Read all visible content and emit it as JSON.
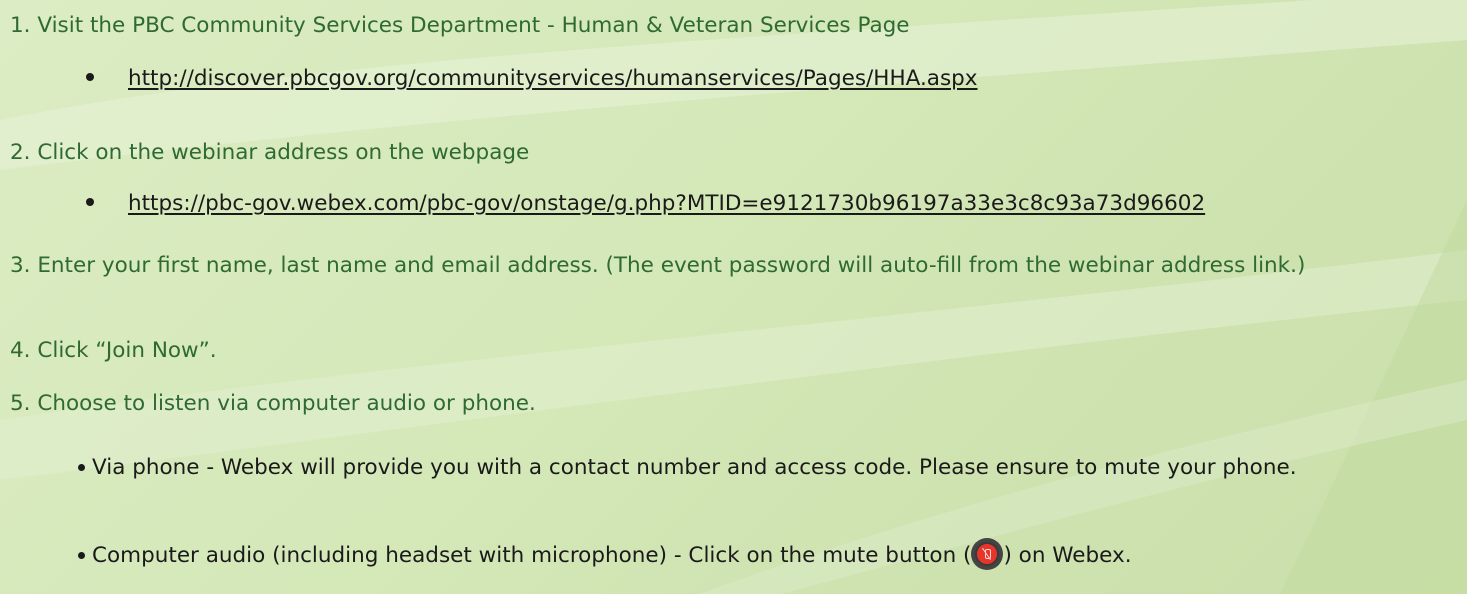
{
  "steps": {
    "s1": "1. Visit the PBC Community Services Department - Human & Veteran Services Page",
    "s1_link": "http://discover.pbcgov.org/communityservices/humanservices/Pages/HHA.aspx",
    "s2": "2. Click on the webinar address on the webpage",
    "s2_link": "https://pbc-gov.webex.com/pbc-gov/onstage/g.php?MTID=e9121730b96197a33e3c8c93a73d96602",
    "s3": "3. Enter your first name, last name and email address.  (The event password will auto-fill from the webinar address link.)",
    "s4": "4. Click “Join Now”.",
    "s5": "5. Choose to listen via computer audio or phone.",
    "s5_phone": "Via phone - Webex will provide you with a contact number and access code. Please ensure to mute your phone.",
    "s5_computer_before": "Computer audio (including headset with microphone) - Click on the mute button (",
    "s5_computer_after": ") on Webex."
  },
  "icons": {
    "mute": "microphone-mute-icon"
  },
  "colors": {
    "step_text": "#2f6a33",
    "body_text": "#1a1a1a",
    "mute_red": "#e8352b"
  }
}
